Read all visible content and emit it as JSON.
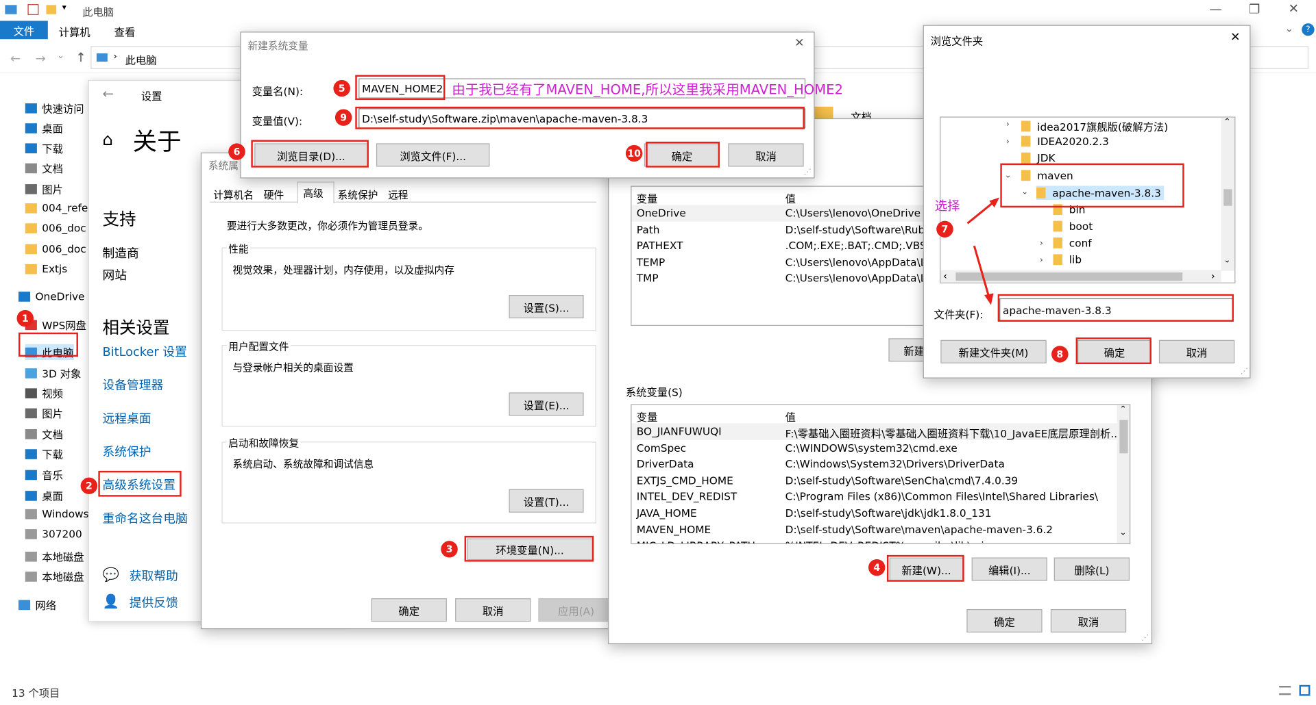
{
  "explorer": {
    "path": "此电脑",
    "title": "此电脑",
    "ribbon_tabs": [
      "文件",
      "计算机",
      "查看"
    ],
    "status": "13 个项目",
    "nav": [
      {
        "label": "快速访问",
        "icon": "star-icon"
      },
      {
        "label": "桌面",
        "icon": "desktop-icon"
      },
      {
        "label": "下载",
        "icon": "download-icon"
      },
      {
        "label": "文档",
        "icon": "document-icon"
      },
      {
        "label": "图片",
        "icon": "picture-icon"
      },
      {
        "label": "004_refe",
        "icon": "folder-icon"
      },
      {
        "label": "006_doc",
        "icon": "folder-icon"
      },
      {
        "label": "006_doc",
        "icon": "folder-icon"
      },
      {
        "label": "Extjs",
        "icon": "folder-icon"
      },
      {
        "label": "OneDrive",
        "icon": "cloud-icon"
      },
      {
        "label": "WPS网盘",
        "icon": "wps-icon"
      },
      {
        "label": "此电脑",
        "icon": "computer-icon"
      },
      {
        "label": "3D 对象",
        "icon": "cube-icon"
      },
      {
        "label": "视频",
        "icon": "video-icon"
      },
      {
        "label": "图片",
        "icon": "picture-icon"
      },
      {
        "label": "文档",
        "icon": "document-icon"
      },
      {
        "label": "下载",
        "icon": "download-icon"
      },
      {
        "label": "音乐",
        "icon": "music-icon"
      },
      {
        "label": "桌面",
        "icon": "desktop-icon"
      },
      {
        "label": "Windows",
        "icon": "drive-icon"
      },
      {
        "label": "307200",
        "icon": "drive-icon"
      },
      {
        "label": "本地磁盘",
        "icon": "drive-icon"
      },
      {
        "label": "本地磁盘",
        "icon": "drive-icon"
      },
      {
        "label": "网络",
        "icon": "network-icon"
      }
    ],
    "content_fragment": "文档"
  },
  "settings": {
    "app": "设置",
    "heading": "关于",
    "support": "支持",
    "support_links": [
      "制造商",
      "网站"
    ],
    "related": "相关设置",
    "related_links": [
      "BitLocker 设置",
      "设备管理器",
      "远程桌面",
      "系统保护",
      "高级系统设置",
      "重命名这台电脑"
    ],
    "help": "获取帮助",
    "feedback": "提供反馈"
  },
  "sysprops": {
    "title": "系统属",
    "tabs": [
      "计算机名",
      "硬件",
      "高级",
      "系统保护",
      "远程"
    ],
    "admin_note": "要进行大多数更改，你必须作为管理员登录。",
    "perf_title": "性能",
    "perf_desc": "视觉效果，处理器计划，内存使用，以及虚拟内存",
    "perf_btn": "设置(S)...",
    "profile_title": "用户配置文件",
    "profile_desc": "与登录帐户相关的桌面设置",
    "profile_btn": "设置(E)...",
    "startup_title": "启动和故障恢复",
    "startup_desc": "系统启动、系统故障和调试信息",
    "startup_btn": "设置(T)...",
    "env_btn": "环境变量(N)...",
    "ok": "确定",
    "cancel": "取消",
    "apply": "应用(A)"
  },
  "envvars": {
    "col_var": "变量",
    "col_val": "值",
    "user_rows": [
      [
        "OneDrive",
        "C:\\Users\\lenovo\\OneDrive"
      ],
      [
        "Path",
        "D:\\self-study\\Software\\Ruby"
      ],
      [
        "PATHEXT",
        ".COM;.EXE;.BAT;.CMD;.VBS;."
      ],
      [
        "TEMP",
        "C:\\Users\\lenovo\\AppData\\L"
      ],
      [
        "TMP",
        "C:\\Users\\lenovo\\AppData\\L"
      ]
    ],
    "user_new": "新建",
    "sys_label": "系统变量(S)",
    "sys_rows": [
      [
        "BO_JIANFUWUQI",
        "F:\\零基础入圈班资料\\零基础入圈班资料下载\\10_JavaEE底层原理剖析..."
      ],
      [
        "ComSpec",
        "C:\\WINDOWS\\system32\\cmd.exe"
      ],
      [
        "DriverData",
        "C:\\Windows\\System32\\Drivers\\DriverData"
      ],
      [
        "EXTJS_CMD_HOME",
        "D:\\self-study\\Software\\SenCha\\cmd\\7.4.0.39"
      ],
      [
        "INTEL_DEV_REDIST",
        "C:\\Program Files (x86)\\Common Files\\Intel\\Shared Libraries\\"
      ],
      [
        "JAVA_HOME",
        "D:\\self-study\\Software\\jdk\\jdk1.8.0_131"
      ],
      [
        "MAVEN_HOME",
        "D:\\self-study\\Software\\maven\\apache-maven-3.6.2"
      ],
      [
        "MIC_LD_LIBRARY_PATH",
        "%INTEL_DEV_REDIST%compiler\\lib\\mic"
      ]
    ],
    "new": "新建(W)...",
    "edit": "编辑(I)...",
    "delete": "删除(L)",
    "ok": "确定",
    "cancel": "取消"
  },
  "newvar": {
    "title": "新建系统变量",
    "name_label": "变量名(N):",
    "name_value": "MAVEN_HOME2",
    "value_label": "变量值(V):",
    "value_value": "D:\\self-study\\Software.zip\\maven\\apache-maven-3.8.3",
    "browse_dir": "浏览目录(D)...",
    "browse_file": "浏览文件(F)...",
    "ok": "确定",
    "cancel": "取消",
    "annotation": "由于我已经有了MAVEN_HOME,所以这里我采用MAVEN_HOME2"
  },
  "browse": {
    "title": "浏览文件夹",
    "tree": [
      "idea2017旗舰版(破解方法)",
      "IDEA2020.2.3",
      "JDK",
      "maven",
      "apache-maven-3.8.3",
      "bin",
      "boot",
      "conf",
      "lib"
    ],
    "folder_label": "文件夹(F):",
    "folder_value": "apache-maven-3.8.3",
    "new_folder": "新建文件夹(M)",
    "ok": "确定",
    "cancel": "取消",
    "select_note": "选择"
  },
  "badges": [
    "1",
    "2",
    "3",
    "4",
    "5",
    "6",
    "7",
    "8",
    "9",
    "10"
  ],
  "colors": {
    "accent": "#0063b1",
    "highlight": "#e8221b",
    "annotation": "#d11fd4",
    "folder": "#f5c04a"
  }
}
